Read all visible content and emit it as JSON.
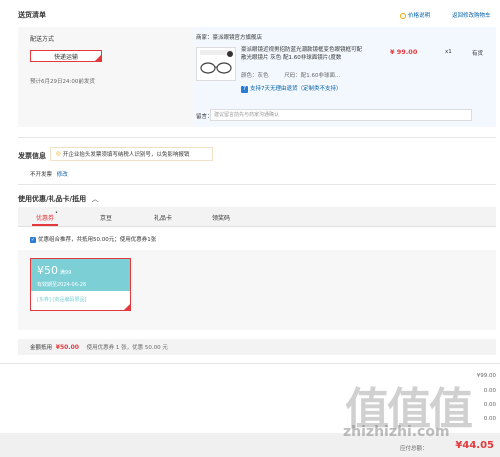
{
  "header": {
    "title": "送货清单",
    "price_note": "价格说明",
    "return_edit": "返回修改购物车"
  },
  "shipping": {
    "label": "配送方式",
    "method": "快递运输",
    "eta": "预计6月29日24:00前发货"
  },
  "goods": {
    "seller": "商家：豪派眼镜官方旗舰店",
    "name": "豪派眼镜近视男招防蓝光潮款镜框变色眼镜框可配散光眼镜片 灰色 配1.60非球面镜片(度数",
    "price": "¥ 99.00",
    "qty": "x1",
    "stock": "有货",
    "color_label": "颜色：",
    "color_value": "灰色",
    "spec_label": "尺码：",
    "spec_value": "配1.60非球面...",
    "support_text": "支持7天无理由退货（定制类不支持）",
    "remark_label": "留言：",
    "remark_placeholder": "建议留言前先与商家沟通确认"
  },
  "invoice": {
    "title": "发票信息",
    "tip": "开企业抬头发票须填写纳税人识别号，以免影响报销",
    "status": "不开发票",
    "edit": "修改"
  },
  "coupons": {
    "title": "使用优惠/礼品卡/抵用",
    "tabs": [
      "优惠券",
      "京豆",
      "礼品卡",
      "领奖码"
    ],
    "combo_text": "优惠组合推荐，共抵用50.00元；使用优惠券1张",
    "coupon_amount": "¥50",
    "coupon_threshold": "满99",
    "coupon_valid": "有效期至2024-06-28",
    "coupon_tags": "[东券] [商品编码限品]"
  },
  "summary": {
    "label": "金额抵用",
    "amount": "¥50.00",
    "detail": "使用优惠券 1 张，优惠 50.00 元"
  },
  "totals": {
    "line1_value": "¥99.00",
    "line2_value": "0.00",
    "line3_value": "0.00",
    "line4_value": "0.00",
    "payable_label": "应付总额：",
    "payable_value": "¥44.05"
  },
  "watermark": {
    "logo": "值值值",
    "url": "zhizhizhi.com"
  }
}
